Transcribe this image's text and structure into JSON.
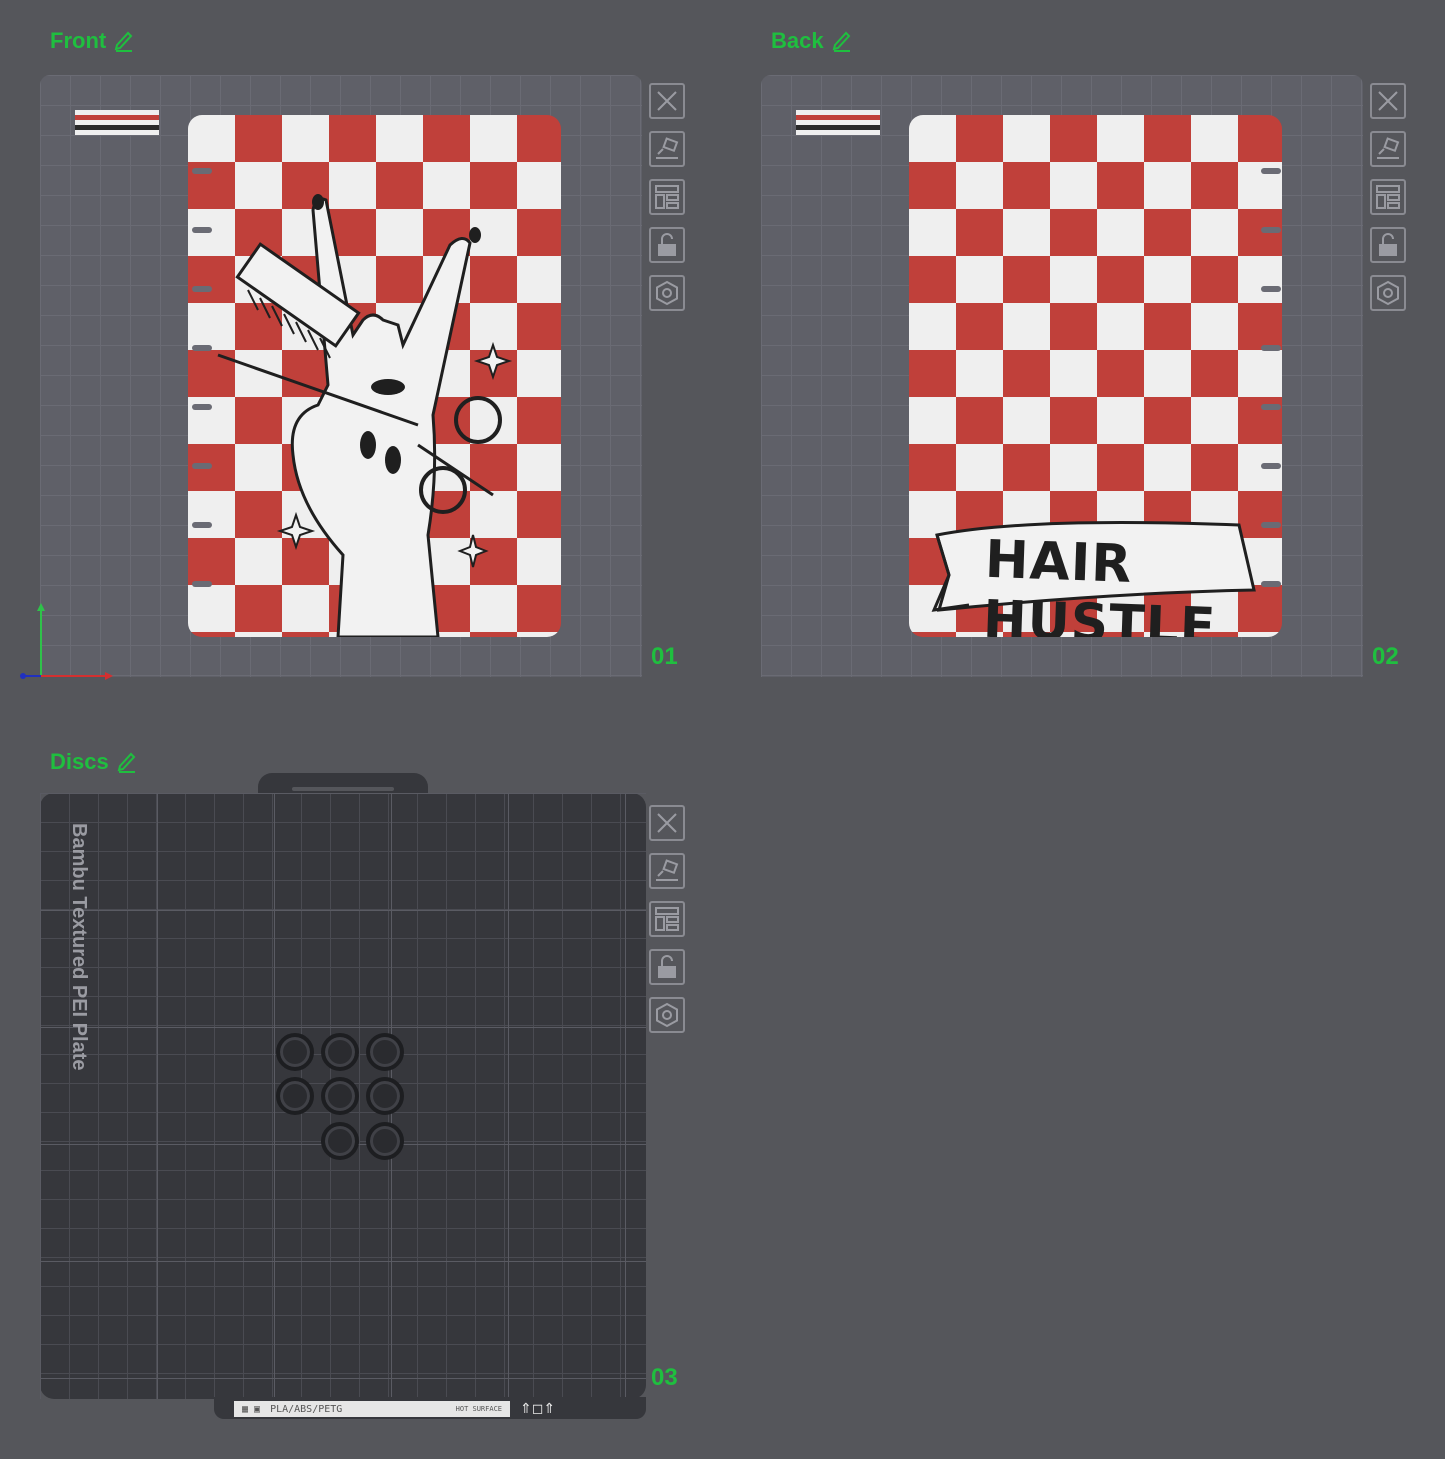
{
  "plates": [
    {
      "label": "Front",
      "number": "01"
    },
    {
      "label": "Back",
      "number": "02"
    },
    {
      "label": "Discs",
      "number": "03"
    }
  ],
  "back_banner": "HAIR HUSTLE",
  "bed": {
    "name": "Bambu Textured PEI Plate",
    "materials": "PLA/ABS/PETG",
    "hot_surface": "HOT SURFACE"
  },
  "colors": {
    "label_green": "#1fbf3f",
    "checker_red": "#c0403a",
    "checker_white": "#efefef"
  },
  "icons": [
    "close-icon",
    "auto-orient-icon",
    "arrange-icon",
    "lock-icon",
    "settings-icon",
    "edit-icon"
  ]
}
